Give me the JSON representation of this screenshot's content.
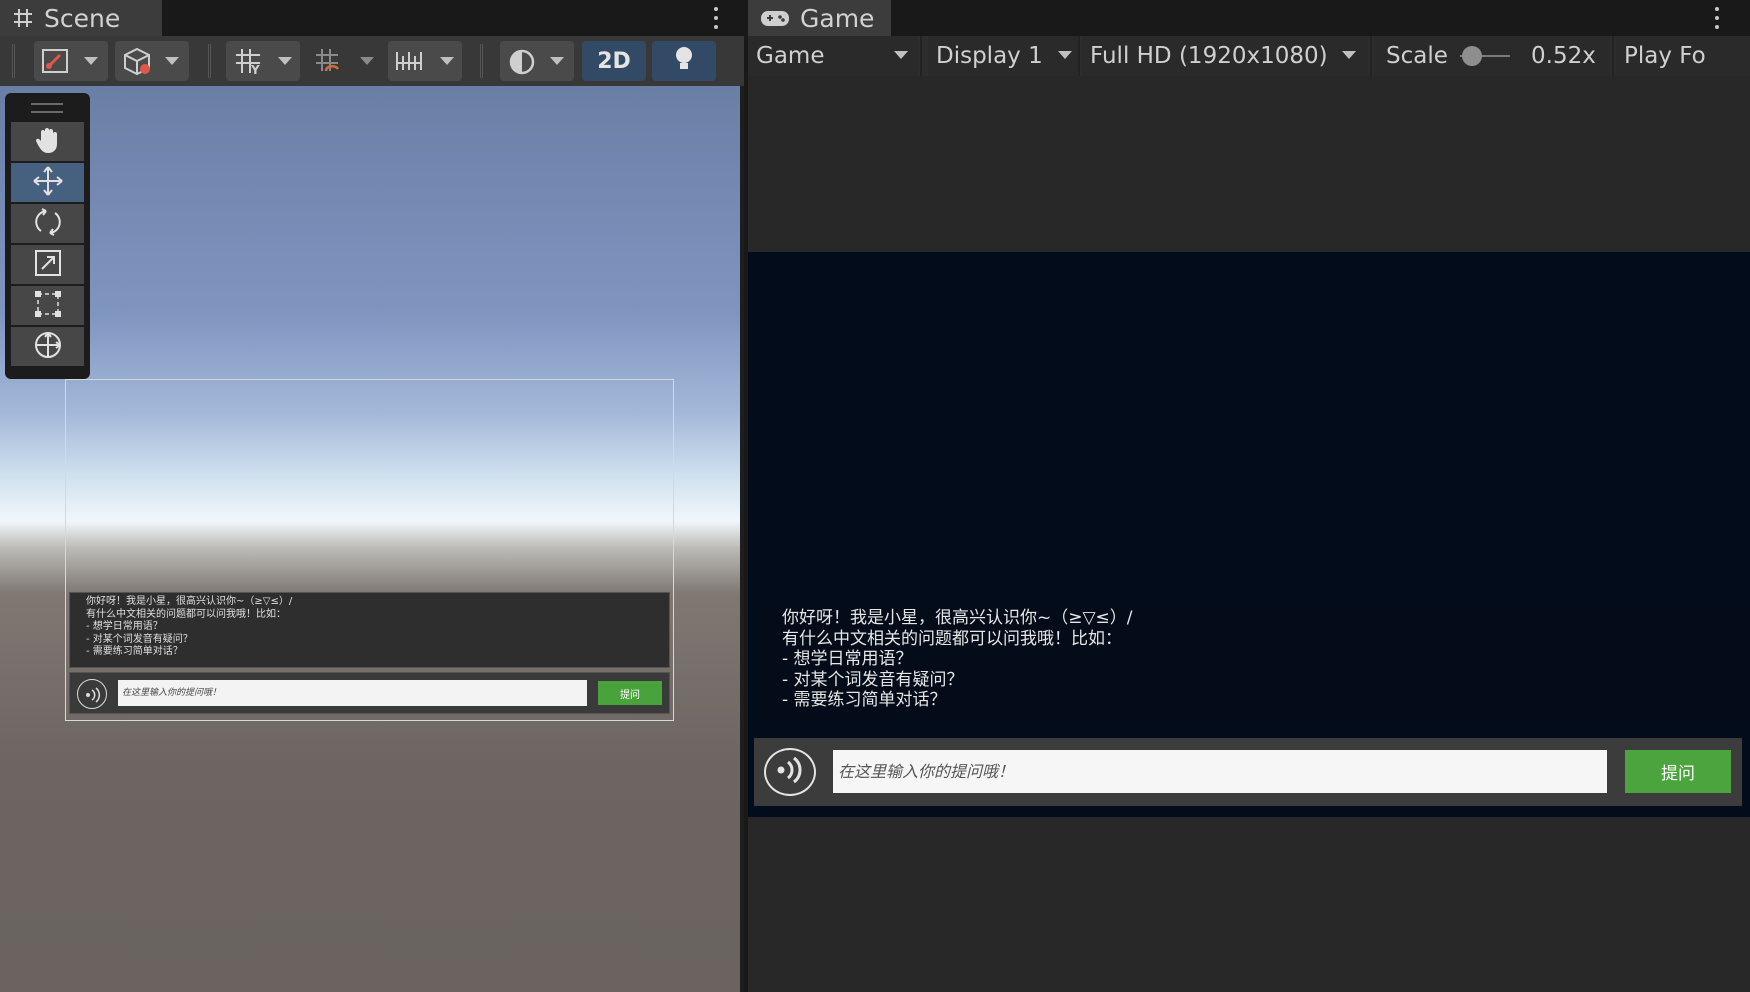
{
  "scene_tab": {
    "title": "Scene",
    "icon": "grid-hash-icon"
  },
  "game_tab": {
    "title": "Game",
    "icon": "gamepad-icon"
  },
  "scene_toolbar": {
    "two_d_label": "2D",
    "buttons": [
      "draw-mode-icon",
      "gizmo-cube-icon",
      "grid-snap-icon",
      "increment-snap-icon",
      "ruler-icon",
      "shading-sphere-icon",
      "lighting-bulb-icon"
    ]
  },
  "tool_palette": [
    "hand-icon",
    "move-icon",
    "rotate-icon",
    "scale-icon",
    "rect-tool-icon",
    "transform-icon"
  ],
  "game_toolbar": {
    "mode": "Game",
    "display": "Display 1",
    "resolution": "Full HD (1920x1080)",
    "scale_label": "Scale",
    "scale_value": "0.52x",
    "scale_level": 0.05,
    "play_focus": "Play Fo"
  },
  "chat": {
    "lines": [
      "你好呀！我是小星，很高兴认识你~（≥▽≤）/",
      "",
      "有什么中文相关的问题都可以问我哦！比如：",
      "- 想学日常用语？",
      "- 对某个词发音有疑问？",
      "- 需要练习简单对话？"
    ],
    "input_placeholder": "在这里输入你的提问哦！",
    "send_label": "提问"
  },
  "colors": {
    "accent_active": "#46607f",
    "send_button": "#4ca43e",
    "game_background": "#030c1a"
  }
}
